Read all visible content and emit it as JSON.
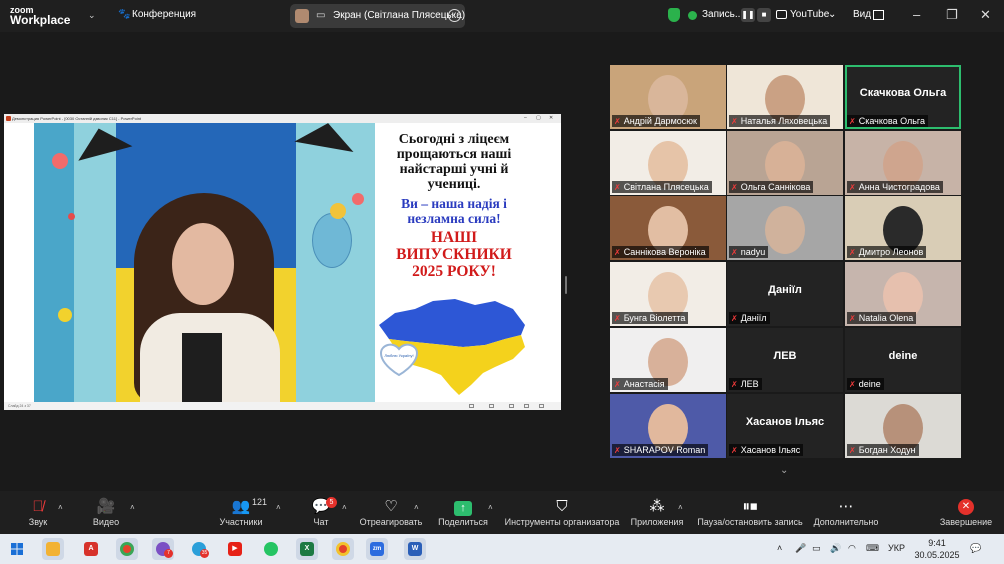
{
  "app": {
    "logo_line1": "zoom",
    "logo_line2": "Workplace",
    "meeting_label": "Конференция"
  },
  "share_indicator": {
    "label": "Экран (Світлана Плясецька)"
  },
  "recording": {
    "label": "Запись..."
  },
  "stream": {
    "label": "YouTube"
  },
  "view": {
    "label": "Вид"
  },
  "shared_window": {
    "title": "Демонстрация PowerPoint - [0030 Останній дзвоник С11] - PowerPoint",
    "status": "Слайд 24 з 37",
    "slide_lines": [
      {
        "text": "Сьогодні з ліцеєм",
        "style": "blk"
      },
      {
        "text": "прощаються наші",
        "style": "blk"
      },
      {
        "text": "найстарші учні й",
        "style": "blk"
      },
      {
        "text": "учениці.",
        "style": "blk"
      },
      {
        "text": "Ви – наша надія  і",
        "style": "blue"
      },
      {
        "text": "незламна сила!",
        "style": "blue"
      },
      {
        "text": "НАШІ",
        "style": "red"
      },
      {
        "text": "ВИПУСКНИКИ",
        "style": "red"
      },
      {
        "text": "2025 РОКУ!",
        "style": "red"
      }
    ],
    "heart_text": "Люблю Україну!"
  },
  "participants": [
    {
      "name": "Андрій Дармосюк",
      "video": true,
      "bg": "#c9a47a",
      "face": "#d9b69a",
      "active": false
    },
    {
      "name": "Наталья Ляховецька",
      "video": true,
      "bg": "#efe6d8",
      "face": "#caa184",
      "active": false
    },
    {
      "name": "Скачкова Ольга",
      "video": false,
      "big": "Скачкова Ольга",
      "active": true
    },
    {
      "name": "Світлана Плясецька",
      "video": true,
      "bg": "#f2ede6",
      "face": "#e6c4a8",
      "active": false
    },
    {
      "name": "Ольга Саннікова",
      "video": true,
      "bg": "#b9a494",
      "face": "#d7b197",
      "active": false
    },
    {
      "name": "Анна Чистоградова",
      "video": true,
      "bg": "#c7b3a7",
      "face": "#cfa58e",
      "active": false
    },
    {
      "name": "Саннікова  Вероніка",
      "video": true,
      "bg": "#8a5a3a",
      "face": "#e2bea3",
      "active": false
    },
    {
      "name": "nadyu",
      "video": true,
      "bg": "#a6a6a6",
      "face": "#d0b29c",
      "active": false
    },
    {
      "name": "Дмитро Леонов",
      "video": true,
      "bg": "#d9cdb6",
      "face": "#2a2a2a",
      "active": false
    },
    {
      "name": "Бунга Віолетта",
      "video": true,
      "bg": "#f2ede6",
      "face": "#e8c9b0",
      "active": false
    },
    {
      "name": "Даніїл",
      "video": false,
      "big": "Даніїл",
      "active": false
    },
    {
      "name": "Natalia Olena",
      "video": true,
      "bg": "#c6b5ad",
      "face": "#e6c0ae",
      "active": false
    },
    {
      "name": "Анастасія",
      "video": true,
      "bg": "#f0efef",
      "face": "#d8b19a",
      "active": false
    },
    {
      "name": "ЛЕВ",
      "video": false,
      "big": "ЛЕВ",
      "active": false
    },
    {
      "name": "deine",
      "video": false,
      "big": "deine",
      "active": false
    },
    {
      "name": "SHARAPOV Roman",
      "video": true,
      "bg": "#4e5aa8",
      "face": "#e1b89d",
      "active": false
    },
    {
      "name": "Хасанов Ільяс",
      "video": false,
      "big": "Хасанов Ільяс",
      "active": false
    },
    {
      "name": "Богдан Ходун",
      "video": true,
      "bg": "#dcdad5",
      "face": "#b7917a",
      "active": false
    }
  ],
  "toolbar": {
    "sound": "Звук",
    "video": "Видео",
    "participants": "Участники",
    "participants_count": "121",
    "chat": "Чат",
    "chat_badge": "5",
    "react": "Отреагировать",
    "share": "Поделиться",
    "host_tools": "Инструменты организатора",
    "apps": "Приложения",
    "pause_record": "Пауза/остановить запись",
    "more": "Дополнительно",
    "end": "Завершение"
  },
  "taskbar": {
    "viber_badge": "7",
    "telegram_badge": "35",
    "language": "УКР",
    "time": "9:41",
    "date": "30.05.2025"
  },
  "colors": {
    "accent_green": "#2dbd6e",
    "end_red": "#e4312b",
    "muted_red": "#f23b3b"
  }
}
